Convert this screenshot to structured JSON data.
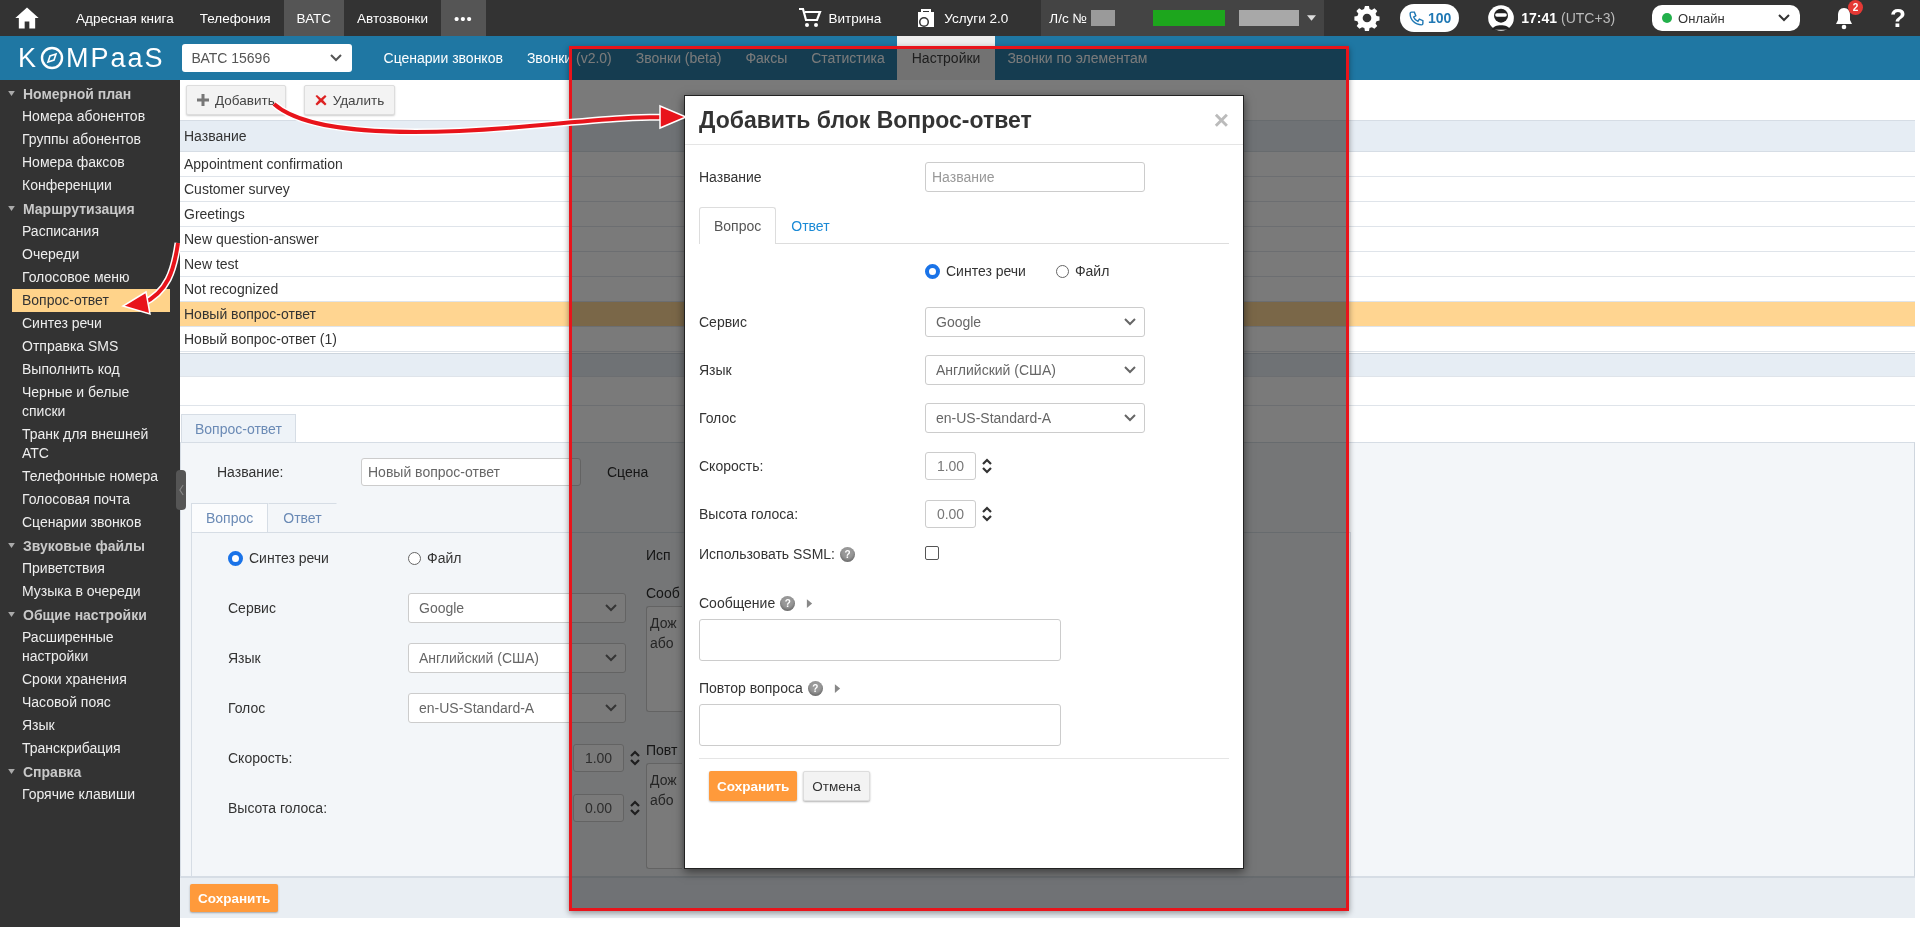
{
  "top_bar": {
    "menu": [
      {
        "label": "Адресная книга",
        "kind": "link",
        "selected": false
      },
      {
        "label": "Телефония",
        "kind": "link",
        "selected": false
      },
      {
        "label": "ВАТС",
        "kind": "link",
        "selected": true
      },
      {
        "label": "Автозвонки",
        "kind": "link",
        "selected": false
      },
      {
        "label": "•••",
        "kind": "more"
      }
    ],
    "shop": "Витрина",
    "services": "Услуги 2.0",
    "account_label": "Л/с №",
    "calls": "100",
    "time": "17:41",
    "timezone": "(UTC+3)",
    "status": {
      "value": "Онлайн",
      "color": "#22b04b"
    },
    "notifications": "2",
    "help": "?"
  },
  "nav": {
    "logo_left": "K",
    "logo_right": "MPaaS",
    "pbx_select": "ВАТС 15696",
    "tabs": [
      {
        "label": "Сценарии звонков",
        "selected": false
      },
      {
        "label": "Звонки (v2.0)",
        "selected": false
      },
      {
        "label": "Звонки (beta)",
        "selected": false
      },
      {
        "label": "Факсы",
        "selected": false
      },
      {
        "label": "Статистика",
        "selected": false
      },
      {
        "label": "Настройки",
        "selected": true
      },
      {
        "label": "Звонки по элементам",
        "selected": false
      }
    ]
  },
  "sidebar": {
    "sections": [
      {
        "title": "Номерной план",
        "expanded": true,
        "items": [
          {
            "label": "Номера абонентов",
            "selected": false
          },
          {
            "label": "Группы абонентов",
            "selected": false
          },
          {
            "label": "Номера факсов",
            "selected": false
          },
          {
            "label": "Конференции",
            "selected": false
          }
        ]
      },
      {
        "title": "Маршрутизация",
        "expanded": true,
        "items": [
          {
            "label": "Расписания",
            "selected": false
          },
          {
            "label": "Очереди",
            "selected": false
          },
          {
            "label": "Голосовое меню",
            "selected": false
          },
          {
            "label": "Вопрос-ответ",
            "selected": true
          },
          {
            "label": "Синтез речи",
            "selected": false
          },
          {
            "label": "Отправка SMS",
            "selected": false
          },
          {
            "label": "Выполнить код",
            "selected": false
          },
          {
            "label": "Черные и белые списки",
            "selected": false
          },
          {
            "label": "Транк для внешней АТС",
            "selected": false
          },
          {
            "label": "Телефонные номера",
            "selected": false
          },
          {
            "label": "Голосовая почта",
            "selected": false
          },
          {
            "label": "Сценарии звонков",
            "selected": false
          }
        ]
      },
      {
        "title": "Звуковые файлы",
        "expanded": true,
        "items": [
          {
            "label": "Приветствия",
            "selected": false
          },
          {
            "label": "Музыка в очереди",
            "selected": false
          }
        ]
      },
      {
        "title": "Общие настройки",
        "expanded": true,
        "items": [
          {
            "label": "Расширенные настройки",
            "selected": false
          },
          {
            "label": "Сроки хранения",
            "selected": false
          },
          {
            "label": "Часовой пояс",
            "selected": false
          },
          {
            "label": "Язык",
            "selected": false
          },
          {
            "label": "Транскрибация",
            "selected": false
          }
        ]
      },
      {
        "title": "Справка",
        "expanded": true,
        "items": [
          {
            "label": "Горячие клавиши",
            "selected": false
          }
        ]
      }
    ]
  },
  "toolbar": {
    "buttons": [
      {
        "label": "Добавить",
        "kind": "add"
      },
      {
        "label": "Удалить",
        "kind": "delete"
      }
    ]
  },
  "table": {
    "columns": [
      "Название"
    ],
    "rows": [
      {
        "name": "Appointment confirmation",
        "selected": false
      },
      {
        "name": "Customer survey",
        "selected": false
      },
      {
        "name": "Greetings",
        "selected": false
      },
      {
        "name": "New question-answer",
        "selected": false
      },
      {
        "name": "New test",
        "selected": false
      },
      {
        "name": "Not recognized",
        "selected": false
      },
      {
        "name": "Новый вопрос-ответ",
        "selected": true
      },
      {
        "name": "Новый вопрос-ответ (1)",
        "selected": false
      }
    ]
  },
  "editor": {
    "tab": "Вопрос-ответ",
    "name_label": "Название:",
    "name_value": "Новый вопрос-ответ",
    "scenario_label": "Сцена",
    "tabs": [
      {
        "label": "Вопрос",
        "selected": true
      },
      {
        "label": "Ответ",
        "selected": false
      }
    ],
    "modes": [
      {
        "label": "Синтез речи",
        "selected": true
      },
      {
        "label": "Файл",
        "selected": false
      }
    ],
    "fields": [
      {
        "label": "Сервис",
        "kind": "select",
        "value": "Google"
      },
      {
        "label": "Язык",
        "kind": "select",
        "value": "Английский (США)"
      },
      {
        "label": "Голос",
        "kind": "select",
        "value": "en-US-Standard-A"
      },
      {
        "label": "Скорость:",
        "kind": "spinner",
        "value": "1.00"
      },
      {
        "label": "Высота голоса:",
        "kind": "spinner",
        "value": "0.00"
      }
    ],
    "ssml_label": "Исп",
    "message_label": "Сооб",
    "message_placeholder": "Дож або",
    "repeat_label": "Повт",
    "repeat_placeholder": "Дож або",
    "save": "Сохранить"
  },
  "modal": {
    "title": "Добавить блок Вопрос-ответ",
    "close": "×",
    "name_label": "Название",
    "name_placeholder": "Название",
    "tabs": [
      {
        "label": "Вопрос",
        "selected": true
      },
      {
        "label": "Ответ",
        "selected": false
      }
    ],
    "modes": [
      {
        "label": "Синтез речи",
        "selected": true
      },
      {
        "label": "Файл",
        "selected": false
      }
    ],
    "fields": [
      {
        "label": "Сервис",
        "kind": "select",
        "value": "Google"
      },
      {
        "label": "Язык",
        "kind": "select",
        "value": "Английский (США)"
      },
      {
        "label": "Голос",
        "kind": "select",
        "value": "en-US-Standard-A"
      },
      {
        "label": "Скорость:",
        "kind": "spinner",
        "value": "1.00"
      },
      {
        "label": "Высота голоса:",
        "kind": "spinner",
        "value": "0.00"
      },
      {
        "label": "Использовать SSML:",
        "kind": "checkbox",
        "checked": false,
        "help": "?"
      }
    ],
    "texts": [
      {
        "label": "Сообщение",
        "help": "?"
      },
      {
        "label": "Повтор вопроса",
        "help": "?"
      }
    ],
    "buttons": [
      {
        "label": "Сохранить",
        "kind": "primary"
      },
      {
        "label": "Отмена",
        "kind": "default"
      }
    ]
  }
}
